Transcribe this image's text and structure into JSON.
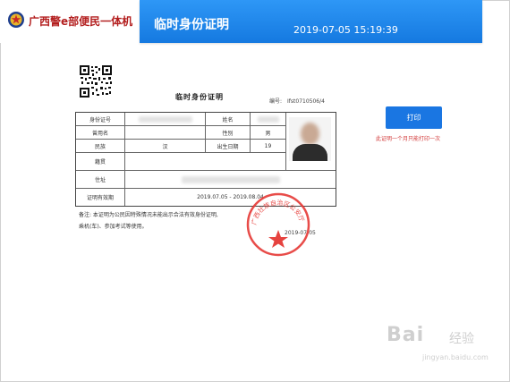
{
  "header": {
    "brand": "广西警e部便民一体机",
    "title": "临时身份证明",
    "datetime": "2019-07-05 15:19:39"
  },
  "document": {
    "title": "临时身份证明",
    "number_label": "编号:",
    "number_value": "Ifst0710506/4",
    "labels": {
      "id_number": "身份证号",
      "name": "姓名",
      "former_name": "曾用名",
      "gender": "性别",
      "ethnicity": "民族",
      "birth_date": "出生日期",
      "native_place": "籍贯",
      "address": "住址",
      "validity": "证明有效期"
    },
    "values": {
      "ethnicity": "汉",
      "gender": "男",
      "birth_date": "19",
      "validity": "2019.07.05 - 2019.08.04"
    },
    "note_line1": "备注: 本证明为公民因特殊情况未能出示合法有效身份证明,",
    "note_line2": "乘机(车)、参加考试等使用。",
    "issue_date": "2019-07-05",
    "seal_text": "广西壮族自治区公安厅"
  },
  "actions": {
    "print_label": "打印",
    "print_note": "此证明一个月只能打印一次"
  },
  "watermark": {
    "logo": "Bai",
    "suffix": "经验",
    "url": "jingyan.baidu.com"
  },
  "colors": {
    "header_blue": "#1e88f0",
    "brand_red": "#b31e1e",
    "button_blue": "#1a76e2",
    "seal_red": "#e53935"
  }
}
